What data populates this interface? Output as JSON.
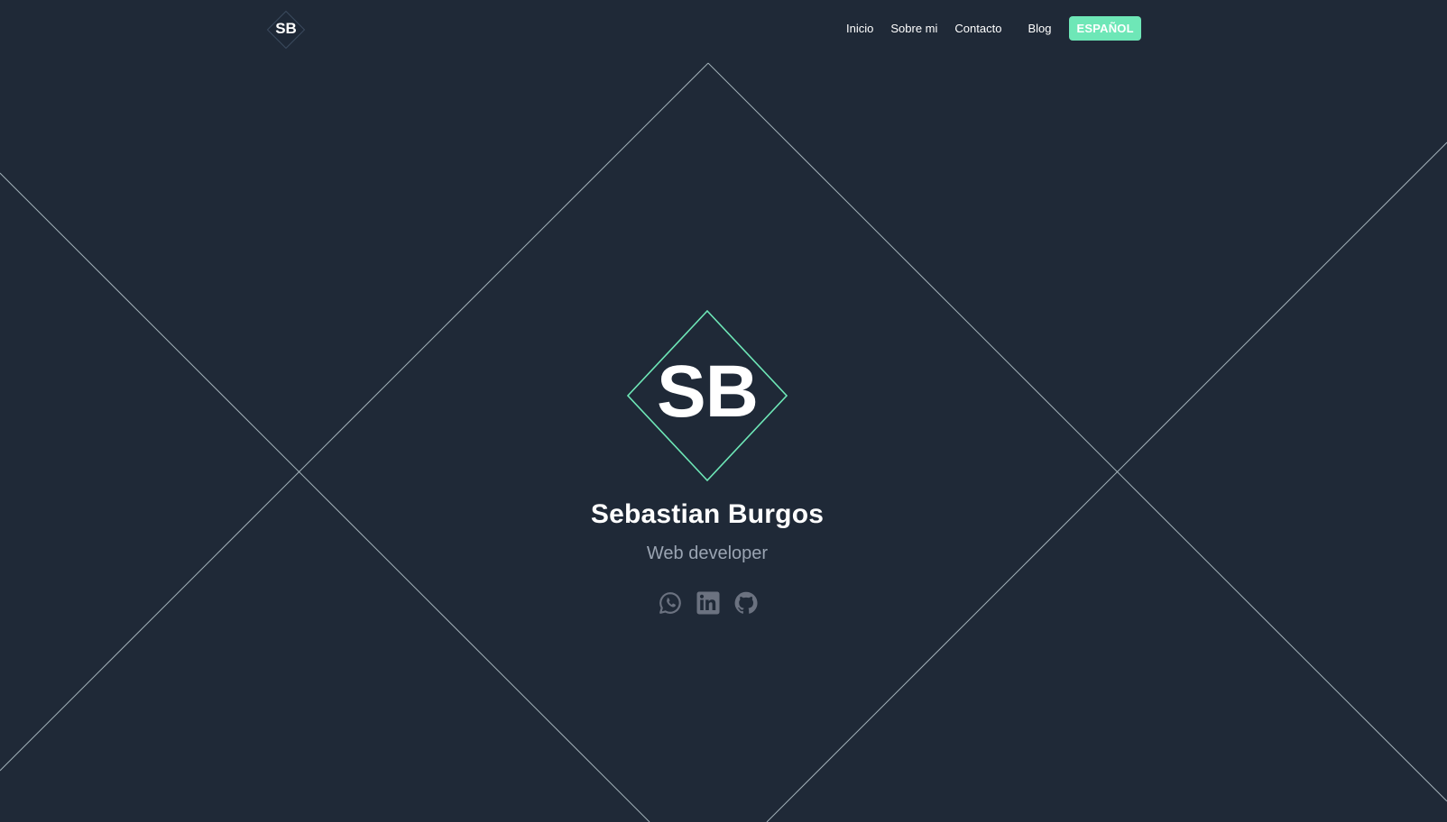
{
  "header": {
    "brand": "SB",
    "nav": [
      {
        "label": "Inicio"
      },
      {
        "label": "Sobre mi"
      },
      {
        "label": "Contacto"
      },
      {
        "label": "Blog"
      }
    ],
    "language_button": "ESPAÑOL"
  },
  "hero": {
    "logo_text": "SB",
    "name": "Sebastian Burgos",
    "role": "Web developer",
    "socials": [
      {
        "icon": "whatsapp-icon"
      },
      {
        "icon": "linkedin-icon"
      },
      {
        "icon": "github-icon"
      }
    ]
  },
  "colors": {
    "background": "#1f2937",
    "accent": "#6ee7b7",
    "text": "#ffffff",
    "muted": "#9aa4b2",
    "icon": "#6b7280"
  }
}
